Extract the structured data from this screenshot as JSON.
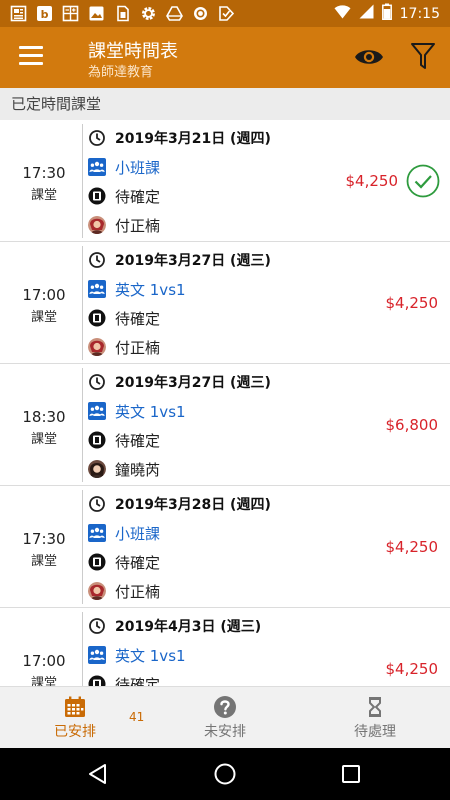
{
  "status_bar": {
    "time": "17:15",
    "icons": [
      "news-icon",
      "b-box-icon",
      "calculator-icon",
      "image-icon",
      "sim-icon",
      "settings-icon",
      "drive-icon",
      "circle-icon",
      "check-badge-icon"
    ]
  },
  "app_bar": {
    "title": "課堂時間表",
    "subtitle": "為師達教育",
    "actions": [
      "eye-icon",
      "filter-icon"
    ],
    "color": "#d27a0e"
  },
  "section": {
    "label": "已定時間課堂"
  },
  "sessions": [
    {
      "time": "17:30",
      "kind": "課堂",
      "date": "2019年3月21日 (週四)",
      "course": "小班課",
      "status": "待確定",
      "teacher": "付正楠",
      "price": "$4,250",
      "confirmed": true
    },
    {
      "time": "17:00",
      "kind": "課堂",
      "date": "2019年3月27日 (週三)",
      "course": "英文 1vs1",
      "status": "待確定",
      "teacher": "付正楠",
      "price": "$4,250",
      "confirmed": false
    },
    {
      "time": "18:30",
      "kind": "課堂",
      "date": "2019年3月27日 (週三)",
      "course": "英文 1vs1",
      "status": "待確定",
      "teacher": "鐘曉芮",
      "price": "$6,800",
      "confirmed": false
    },
    {
      "time": "17:30",
      "kind": "課堂",
      "date": "2019年3月28日 (週四)",
      "course": "小班課",
      "status": "待確定",
      "teacher": "付正楠",
      "price": "$4,250",
      "confirmed": false
    },
    {
      "time": "17:00",
      "kind": "課堂",
      "date": "2019年4月3日 (週三)",
      "course": "英文 1vs1",
      "status": "待確定",
      "teacher": "",
      "price": "$4,250",
      "confirmed": false
    }
  ],
  "bottom_nav": {
    "tabs": [
      {
        "label": "已安排",
        "icon": "calendar-icon",
        "active": true
      },
      {
        "label": "未安排",
        "icon": "help-icon",
        "active": false
      },
      {
        "label": "待處理",
        "icon": "hourglass-icon",
        "active": false
      }
    ],
    "badge": "41"
  },
  "colors": {
    "accent": "#d27a0e",
    "status_bar": "#b66607",
    "price": "#d8232a",
    "course_link": "#1a66c9",
    "confirmed": "#2e9b3e"
  }
}
